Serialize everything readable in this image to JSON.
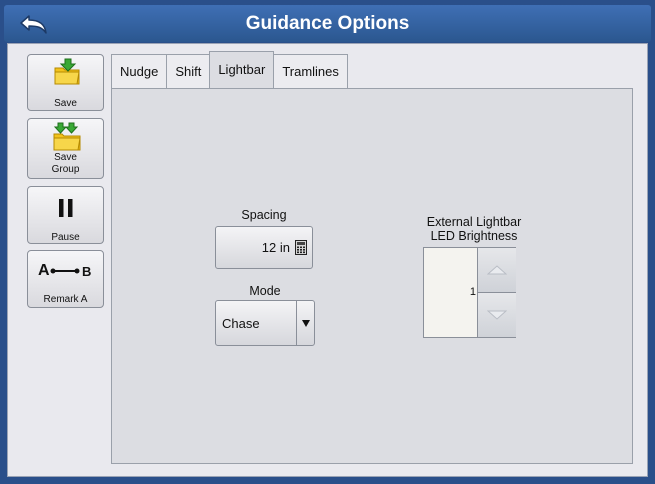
{
  "header": {
    "title": "Guidance Options",
    "back_icon": "back-arrow-icon"
  },
  "sidebar": {
    "save_label": "Save",
    "save_group_label_1": "Save",
    "save_group_label_2": "Group",
    "pause_label": "Pause",
    "remark_label": "Remark A",
    "remark_icon_a": "A",
    "remark_icon_b": "B"
  },
  "tabs": [
    {
      "label": "Nudge"
    },
    {
      "label": "Shift"
    },
    {
      "label": "Lightbar"
    },
    {
      "label": "Tramlines"
    }
  ],
  "active_tab": "Lightbar",
  "spacing": {
    "label": "Spacing",
    "value": "12 in"
  },
  "mode": {
    "label": "Mode",
    "value": "Chase"
  },
  "led": {
    "label_1": "External Lightbar",
    "label_2": "LED Brightness",
    "value": "1"
  },
  "colors": {
    "title_bar": "#2b578f",
    "panel_bg": "#dcdde2",
    "folder_yellow": "#f2c21b",
    "arrow_green": "#39a935"
  }
}
